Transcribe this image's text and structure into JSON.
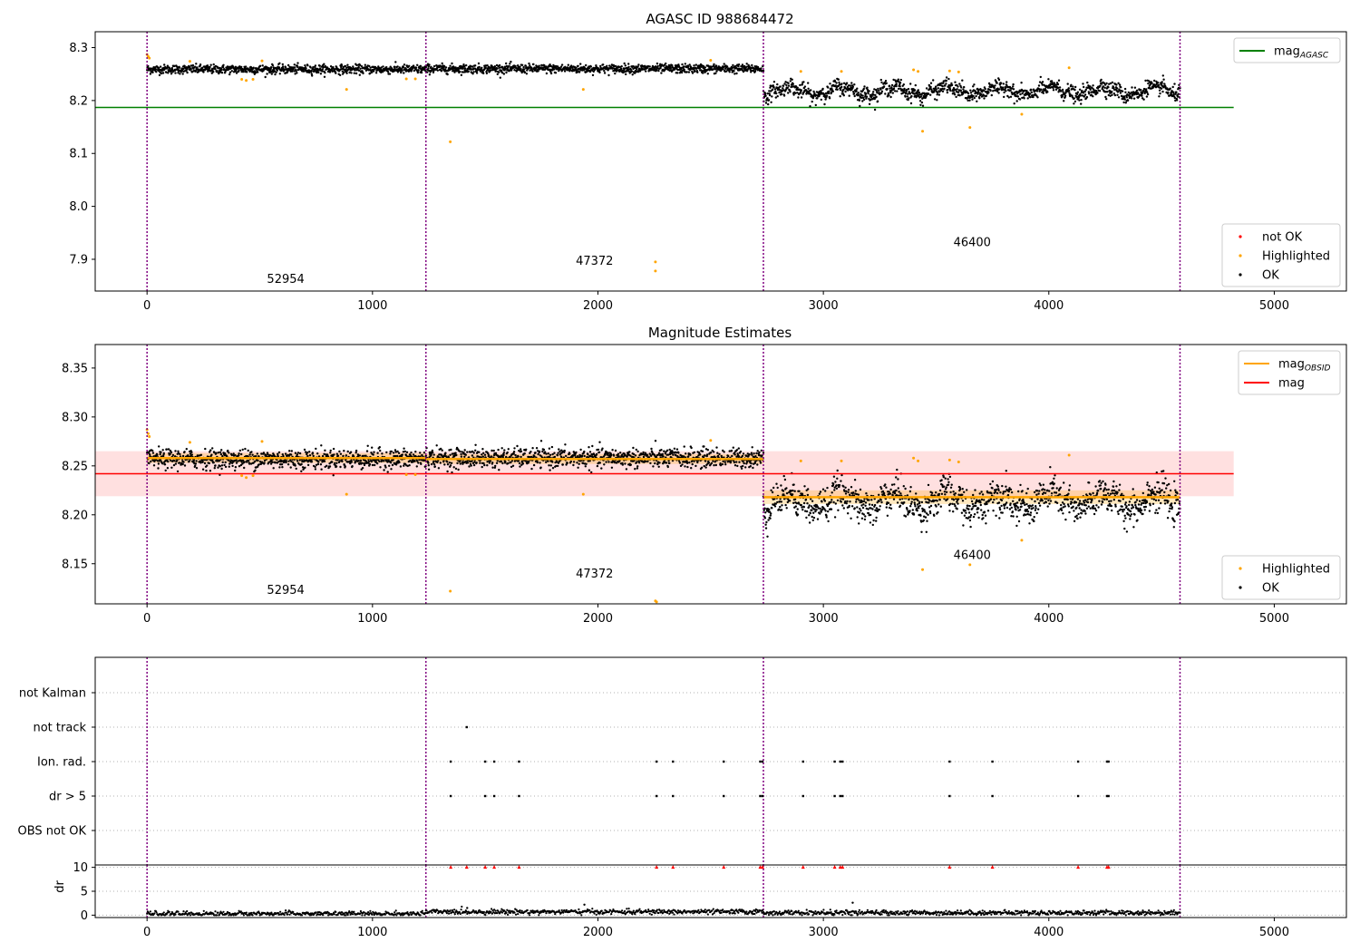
{
  "figure": {
    "title_top": "AGASC ID 988684472",
    "title_middle": "Magnitude Estimates"
  },
  "chart_data": [
    {
      "type": "scatter",
      "title": "AGASC ID 988684472",
      "xlim": [
        -230,
        5320
      ],
      "ylim": [
        7.84,
        8.33
      ],
      "xticks": [
        0,
        1000,
        2000,
        3000,
        4000,
        5000
      ],
      "yticks": [
        7.9,
        8.0,
        8.1,
        8.2,
        8.3
      ],
      "ytick_labels": [
        "7.9",
        "8.0",
        "8.1",
        "8.2",
        "8.3"
      ],
      "grid": false,
      "legends": [
        {
          "position": "top-right",
          "entries": [
            {
              "label": "mag",
              "sub": "AGASC",
              "color": "#008000",
              "kind": "line"
            }
          ]
        },
        {
          "position": "bottom-right",
          "entries": [
            {
              "label": "not OK",
              "color": "#ff0000",
              "kind": "dot"
            },
            {
              "label": "Highlighted",
              "color": "#ffa500",
              "kind": "dot"
            },
            {
              "label": "OK",
              "color": "#000000",
              "kind": "dot"
            }
          ]
        }
      ],
      "observation_boundaries": [
        0,
        1237,
        2734,
        4582
      ],
      "reference_lines": [
        {
          "name": "mag_AGASC",
          "y": 8.187,
          "x": [
            -230,
            4820
          ],
          "color": "#008000"
        }
      ],
      "segments": [
        {
          "x": [
            0,
            1237
          ],
          "ok_mean": 8.259,
          "ok_spread": 0.006
        },
        {
          "x": [
            1237,
            2734
          ],
          "ok_mean": 8.26,
          "ok_spread": 0.006
        },
        {
          "x": [
            2734,
            4582
          ],
          "ok_mean": 8.218,
          "ok_spread": 0.01
        }
      ],
      "highlighted_points": [
        [
          0,
          8.287
        ],
        [
          5,
          8.283
        ],
        [
          10,
          8.28
        ],
        [
          190,
          8.274
        ],
        [
          420,
          8.24
        ],
        [
          440,
          8.238
        ],
        [
          470,
          8.24
        ],
        [
          510,
          8.275
        ],
        [
          885,
          8.221
        ],
        [
          1150,
          8.241
        ],
        [
          1190,
          8.241
        ],
        [
          1345,
          8.122
        ],
        [
          1935,
          8.221
        ],
        [
          2255,
          7.895
        ],
        [
          2255,
          7.878
        ],
        [
          2500,
          8.276
        ],
        [
          2900,
          8.255
        ],
        [
          3080,
          8.255
        ],
        [
          3400,
          8.258
        ],
        [
          3420,
          8.255
        ],
        [
          3440,
          8.142
        ],
        [
          3560,
          8.256
        ],
        [
          3600,
          8.254
        ],
        [
          3650,
          8.149
        ],
        [
          3880,
          8.174
        ],
        [
          4090,
          8.262
        ]
      ],
      "annotations": [
        {
          "text": "52954",
          "x": 615,
          "y": 7.855
        },
        {
          "text": "47372",
          "x": 1985,
          "y": 7.89
        },
        {
          "text": "46400",
          "x": 3660,
          "y": 7.925
        }
      ]
    },
    {
      "type": "scatter",
      "title": "Magnitude Estimates",
      "xlim": [
        -230,
        5320
      ],
      "ylim": [
        8.109,
        8.374
      ],
      "xticks": [
        0,
        1000,
        2000,
        3000,
        4000,
        5000
      ],
      "yticks": [
        8.15,
        8.2,
        8.25,
        8.3,
        8.35
      ],
      "ytick_labels": [
        "8.15",
        "8.20",
        "8.25",
        "8.30",
        "8.35"
      ],
      "grid": false,
      "legends": [
        {
          "position": "top-right",
          "entries": [
            {
              "label": "mag",
              "sub": "OBSID",
              "color": "#ffa500",
              "kind": "line"
            },
            {
              "label": "mag",
              "sub": "",
              "color": "#ff0000",
              "kind": "line"
            }
          ]
        },
        {
          "position": "bottom-right",
          "entries": [
            {
              "label": "Highlighted",
              "color": "#ffa500",
              "kind": "dot"
            },
            {
              "label": "OK",
              "color": "#000000",
              "kind": "dot"
            }
          ]
        }
      ],
      "observation_boundaries": [
        0,
        1237,
        2734,
        4582
      ],
      "mag": {
        "y": 8.242,
        "band": [
          8.219,
          8.265
        ],
        "x": [
          -230,
          4820
        ]
      },
      "mag_obsid": [
        {
          "x": [
            0,
            1237
          ],
          "y": 8.258,
          "band": [
            8.253,
            8.263
          ]
        },
        {
          "x": [
            1237,
            2734
          ],
          "y": 8.257,
          "band": [
            8.252,
            8.262
          ]
        },
        {
          "x": [
            2734,
            4582
          ],
          "y": 8.218,
          "band": [
            8.211,
            8.225
          ]
        }
      ],
      "segments": [
        {
          "x": [
            0,
            1237
          ],
          "ok_mean": 8.257,
          "ok_spread": 0.007
        },
        {
          "x": [
            1237,
            2734
          ],
          "ok_mean": 8.258,
          "ok_spread": 0.007
        },
        {
          "x": [
            2734,
            4582
          ],
          "ok_mean": 8.214,
          "ok_spread": 0.012
        }
      ],
      "highlighted_points": [
        [
          0,
          8.287
        ],
        [
          5,
          8.283
        ],
        [
          10,
          8.28
        ],
        [
          190,
          8.274
        ],
        [
          420,
          8.24
        ],
        [
          440,
          8.238
        ],
        [
          470,
          8.24
        ],
        [
          510,
          8.275
        ],
        [
          885,
          8.221
        ],
        [
          1150,
          8.241
        ],
        [
          1190,
          8.241
        ],
        [
          1345,
          8.122
        ],
        [
          1935,
          8.221
        ],
        [
          2255,
          8.112
        ],
        [
          2260,
          8.111
        ],
        [
          2500,
          8.276
        ],
        [
          2900,
          8.255
        ],
        [
          3080,
          8.255
        ],
        [
          3400,
          8.258
        ],
        [
          3420,
          8.255
        ],
        [
          3440,
          8.144
        ],
        [
          3560,
          8.256
        ],
        [
          3600,
          8.254
        ],
        [
          3650,
          8.149
        ],
        [
          3880,
          8.174
        ],
        [
          4090,
          8.261
        ]
      ],
      "annotations": [
        {
          "text": "52954",
          "x": 615,
          "y": 8.119
        },
        {
          "text": "47372",
          "x": 1985,
          "y": 8.136
        },
        {
          "text": "46400",
          "x": 3660,
          "y": 8.155
        }
      ]
    },
    {
      "type": "scatter",
      "title": "",
      "xlim": [
        -230,
        5320
      ],
      "categories": [
        "not Kalman",
        "not track",
        "Ion. rad.",
        "dr > 5",
        "OBS not OK"
      ],
      "grid": true,
      "observation_boundaries": [
        0,
        1237,
        2734,
        4582
      ],
      "flag_points": {
        "not track": [
          1418
        ],
        "Ion. rad.": [
          1347,
          1500,
          1540,
          1650,
          2260,
          2333,
          2558,
          2720,
          2730,
          2910,
          3050,
          3075,
          3085,
          3560,
          3750,
          4130,
          4258,
          4265
        ],
        "dr > 5": [
          1347,
          1500,
          1540,
          1650,
          2260,
          2333,
          2558,
          2720,
          2730,
          2910,
          3050,
          3075,
          3085,
          3560,
          3750,
          4130,
          4258,
          4265
        ]
      }
    },
    {
      "type": "scatter",
      "title": "",
      "xlim": [
        -230,
        5320
      ],
      "ylim": [
        -0.5,
        10.5
      ],
      "xticks": [
        0,
        1000,
        2000,
        3000,
        4000,
        5000
      ],
      "yticks": [
        0,
        5,
        10
      ],
      "ytick_labels": [
        "0",
        "5",
        "10"
      ],
      "ylabel": "dr",
      "grid": true,
      "observation_boundaries": [
        0,
        1237,
        2734,
        4582
      ],
      "clipped_points_at_10": [
        1347,
        1418,
        1500,
        1540,
        1650,
        2260,
        2333,
        2558,
        2720,
        2730,
        2910,
        3050,
        3075,
        3085,
        3560,
        3750,
        4130,
        4258,
        4265
      ],
      "segments": [
        {
          "x": [
            0,
            1237
          ],
          "mean": 0.3
        },
        {
          "x": [
            1237,
            2734
          ],
          "mean": 0.7
        },
        {
          "x": [
            2734,
            4582
          ],
          "mean": 0.5
        }
      ],
      "outliers": [
        [
          1940,
          2.2
        ],
        [
          3130,
          2.6
        ],
        [
          1420,
          1.5
        ]
      ]
    }
  ]
}
